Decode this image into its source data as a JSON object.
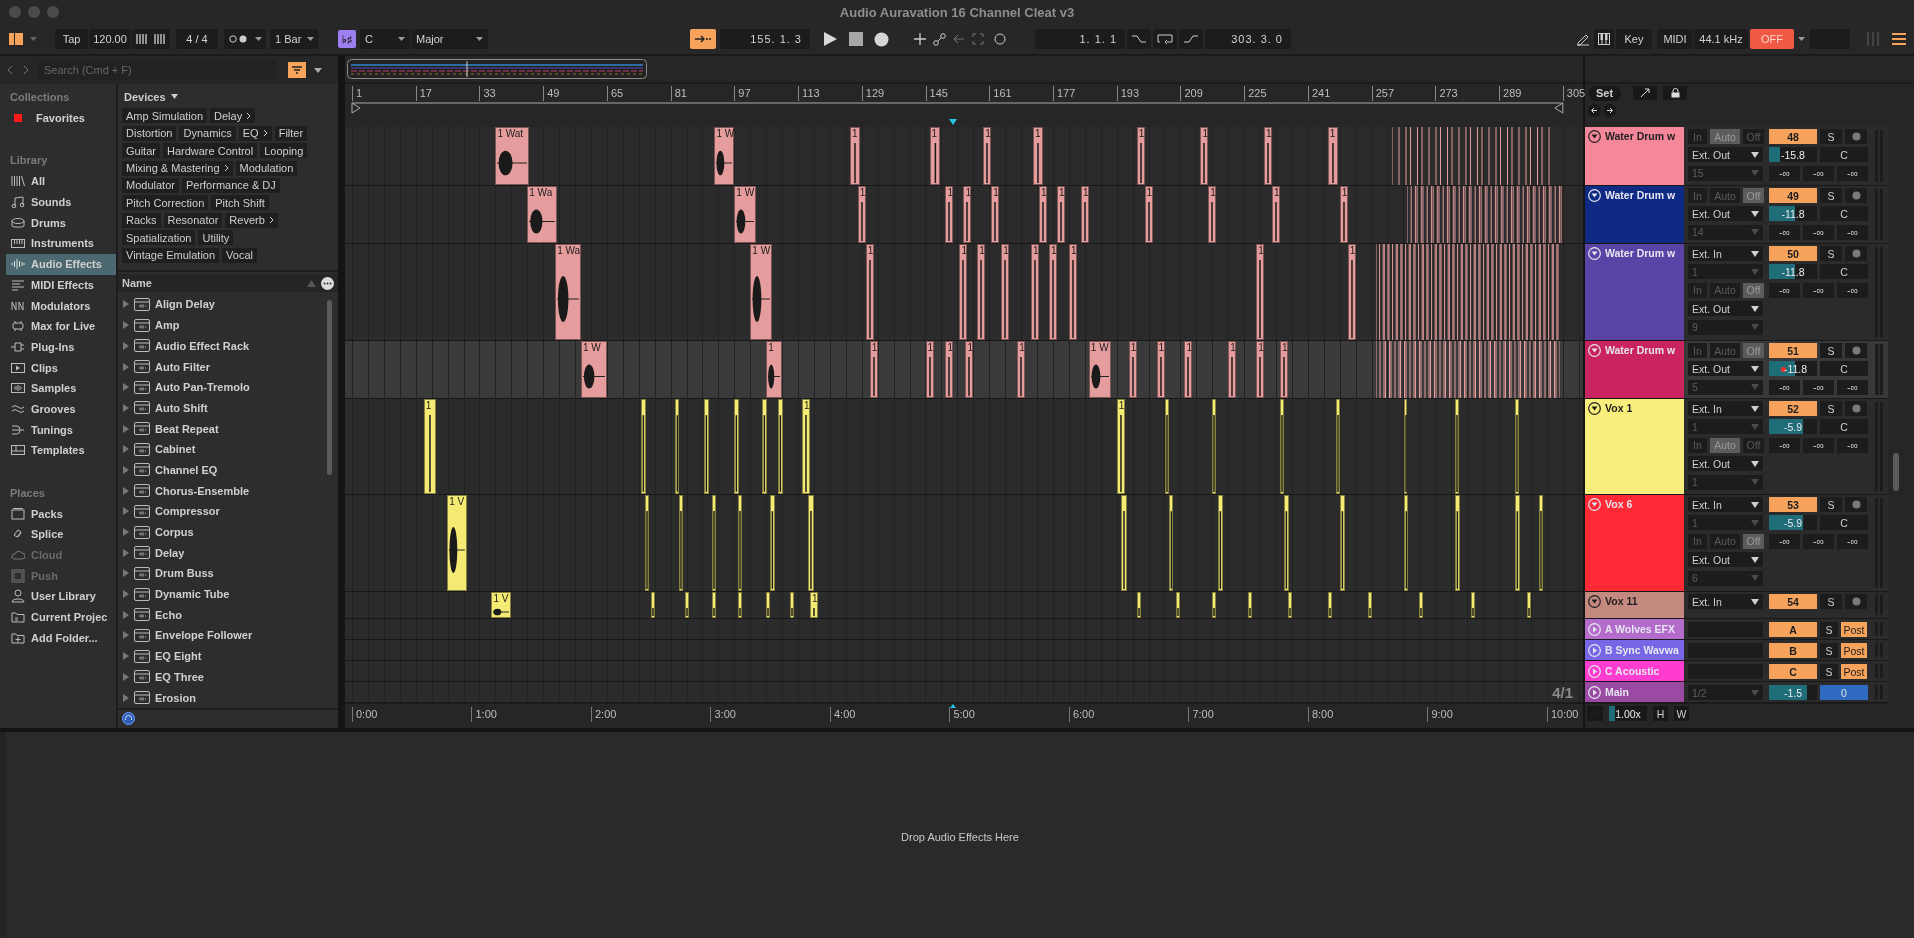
{
  "window": {
    "title": "Audio Auravation 16 Channel Cleat v3"
  },
  "transport": {
    "tap": "Tap",
    "tempo": "120.00",
    "signature": "4 / 4",
    "quantize": "1 Bar",
    "key_signature": "♭♯",
    "key": "C",
    "scale": "Major",
    "position": "155. 1. 3",
    "loop_start": "1. 1. 1",
    "loop_length": "303. 3. 0",
    "key_map": "Key",
    "midi_map": "MIDI",
    "sample_rate": "44.1 kHz",
    "status": "OFF"
  },
  "browser": {
    "search": {
      "placeholder": "Search (Cmd + F)"
    },
    "collections": {
      "heading": "Collections",
      "items": [
        {
          "label": "Favorites",
          "color": "#ff1a1a"
        }
      ]
    },
    "library": {
      "heading": "Library",
      "items": [
        {
          "label": "All",
          "selected": false
        },
        {
          "label": "Sounds",
          "selected": false
        },
        {
          "label": "Drums",
          "selected": false
        },
        {
          "label": "Instruments",
          "selected": false
        },
        {
          "label": "Audio Effects",
          "selected": true
        },
        {
          "label": "MIDI Effects",
          "selected": false
        },
        {
          "label": "Modulators",
          "selected": false
        },
        {
          "label": "Max for Live",
          "selected": false
        },
        {
          "label": "Plug-Ins",
          "selected": false
        },
        {
          "label": "Clips",
          "selected": false
        },
        {
          "label": "Samples",
          "selected": false
        },
        {
          "label": "Grooves",
          "selected": false
        },
        {
          "label": "Tunings",
          "selected": false
        },
        {
          "label": "Templates",
          "selected": false
        }
      ]
    },
    "places": {
      "heading": "Places",
      "items": [
        {
          "label": "Packs",
          "disabled": false
        },
        {
          "label": "Splice",
          "disabled": false
        },
        {
          "label": "Cloud",
          "disabled": true
        },
        {
          "label": "Push",
          "disabled": true
        },
        {
          "label": "User Library",
          "disabled": false
        },
        {
          "label": "Current Projec",
          "disabled": false
        },
        {
          "label": "Add Folder...",
          "disabled": false
        }
      ]
    },
    "devices": {
      "heading": "Devices",
      "tags": [
        {
          "label": "Amp Simulation",
          "expandable": false
        },
        {
          "label": "Delay",
          "expandable": true
        },
        {
          "label": "Distortion",
          "expandable": false
        },
        {
          "label": "Dynamics",
          "expandable": false
        },
        {
          "label": "EQ",
          "expandable": true
        },
        {
          "label": "Filter",
          "expandable": false
        },
        {
          "label": "Guitar",
          "expandable": false
        },
        {
          "label": "Hardware Control",
          "expandable": false
        },
        {
          "label": "Looping",
          "expandable": false
        },
        {
          "label": "Mixing & Mastering",
          "expandable": true
        },
        {
          "label": "Modulation",
          "expandable": false
        },
        {
          "label": "Modulator",
          "expandable": false
        },
        {
          "label": "Performance & DJ",
          "expandable": false
        },
        {
          "label": "Pitch Correction",
          "expandable": false
        },
        {
          "label": "Pitch Shift",
          "expandable": false
        },
        {
          "label": "Racks",
          "expandable": false
        },
        {
          "label": "Resonator",
          "expandable": false
        },
        {
          "label": "Reverb",
          "expandable": true
        },
        {
          "label": "Spatialization",
          "expandable": false
        },
        {
          "label": "Utility",
          "expandable": false
        },
        {
          "label": "Vintage Emulation",
          "expandable": false
        },
        {
          "label": "Vocal",
          "expandable": false
        }
      ]
    },
    "list": {
      "column": "Name",
      "items": [
        "Align Delay",
        "Amp",
        "Audio Effect Rack",
        "Auto Filter",
        "Auto Pan-Tremolo",
        "Auto Shift",
        "Beat Repeat",
        "Cabinet",
        "Channel EQ",
        "Chorus-Ensemble",
        "Compressor",
        "Corpus",
        "Delay",
        "Drum Buss",
        "Dynamic Tube",
        "Echo",
        "Envelope Follower",
        "EQ Eight",
        "EQ Three",
        "Erosion"
      ]
    }
  },
  "arrangement": {
    "ruler": [
      "1",
      "17",
      "33",
      "49",
      "65",
      "81",
      "97",
      "113",
      "129",
      "145",
      "161",
      "177",
      "193",
      "209",
      "225",
      "241",
      "257",
      "273",
      "289",
      "305"
    ],
    "time_ruler": [
      "0:00",
      "1:00",
      "2:00",
      "3:00",
      "4:00",
      "5:00",
      "6:00",
      "7:00",
      "8:00",
      "9:00",
      "10:00"
    ],
    "zoom_label": "4/1"
  },
  "header": {
    "set": "Set"
  },
  "tracks": [
    {
      "kind": "audio",
      "name": "Water Drum w",
      "color": "#f4889a",
      "selected": false,
      "clips": [
        {
          "label": "1 Wat",
          "color": "#e59c9c"
        },
        {
          "label": "1 W",
          "color": "#e59c9c"
        },
        {
          "label": "1",
          "color": "#e59c9c"
        },
        {
          "label": "1",
          "color": "#e59c9c"
        },
        {
          "label": "1",
          "color": "#e59c9c"
        },
        {
          "label": "1",
          "color": "#e59c9c"
        },
        {
          "label": "1",
          "color": "#e59c9c"
        },
        {
          "label": "1",
          "color": "#e59c9c"
        },
        {
          "label": "1",
          "color": "#e59c9c"
        },
        {
          "label": "1",
          "color": "#e59c9c"
        }
      ],
      "io": [
        {
          "kind": "monitor",
          "options": [
            {
              "label": "In",
              "selected": false
            },
            {
              "label": "Auto",
              "selected": true
            },
            {
              "label": "Off",
              "selected": false
            }
          ]
        },
        {
          "kind": "dropdown",
          "value": "Ext. Out",
          "disabled": false
        },
        {
          "kind": "dropdown",
          "value": "15",
          "disabled": true
        }
      ],
      "number": "48",
      "solo": "S",
      "volume": {
        "value": "-15.8",
        "level": 0.22
      },
      "automated": false,
      "pan": "C",
      "sends": [
        "-∞",
        "-∞",
        "-∞"
      ]
    },
    {
      "kind": "audio",
      "name": "Water Drum w",
      "color": "#0f2a84",
      "selected": false,
      "clips": [
        {
          "label": "1 Wa",
          "color": "#e59c9c"
        },
        {
          "label": "1 W",
          "color": "#e59c9c"
        },
        {
          "label": "1",
          "color": "#e59c9c"
        },
        {
          "label": "1",
          "color": "#e59c9c"
        },
        {
          "label": "1",
          "color": "#e59c9c"
        },
        {
          "label": "1",
          "color": "#e59c9c"
        },
        {
          "label": "1",
          "color": "#e59c9c"
        },
        {
          "label": "1",
          "color": "#e59c9c"
        },
        {
          "label": "1",
          "color": "#e59c9c"
        },
        {
          "label": "1",
          "color": "#e59c9c"
        },
        {
          "label": "1",
          "color": "#e59c9c"
        },
        {
          "label": "1",
          "color": "#e59c9c"
        },
        {
          "label": "1",
          "color": "#e59c9c"
        }
      ],
      "io": [
        {
          "kind": "monitor",
          "options": [
            {
              "label": "In",
              "selected": false
            },
            {
              "label": "Auto",
              "selected": false
            },
            {
              "label": "Off",
              "selected": true
            }
          ]
        },
        {
          "kind": "dropdown",
          "value": "Ext. Out",
          "disabled": false
        },
        {
          "kind": "dropdown",
          "value": "14",
          "disabled": true
        }
      ],
      "number": "49",
      "solo": "S",
      "volume": {
        "value": "-11.8",
        "level": 0.54
      },
      "automated": false,
      "pan": "C",
      "sends": [
        "-∞",
        "-∞",
        "-∞"
      ]
    },
    {
      "kind": "audio",
      "name": "Water Drum w",
      "color": "#5944a6",
      "selected": false,
      "clips": [
        {
          "label": "1 Wa",
          "color": "#e59c9c"
        },
        {
          "label": "1 W",
          "color": "#e59c9c"
        },
        {
          "label": "1",
          "color": "#e59c9c"
        },
        {
          "label": "1",
          "color": "#e59c9c"
        },
        {
          "label": "1",
          "color": "#e59c9c"
        },
        {
          "label": "1",
          "color": "#e59c9c"
        },
        {
          "label": "1",
          "color": "#e59c9c"
        },
        {
          "label": "1",
          "color": "#e59c9c"
        },
        {
          "label": "1",
          "color": "#e59c9c"
        },
        {
          "label": "1",
          "color": "#e59c9c"
        },
        {
          "label": "1",
          "color": "#e59c9c"
        }
      ],
      "io": [
        {
          "kind": "dropdown",
          "value": "Ext. In",
          "disabled": false
        },
        {
          "kind": "dropdown",
          "value": "1",
          "disabled": true
        },
        {
          "kind": "monitor",
          "options": [
            {
              "label": "In",
              "selected": false
            },
            {
              "label": "Auto",
              "selected": false
            },
            {
              "label": "Off",
              "selected": true
            }
          ]
        },
        {
          "kind": "dropdown",
          "value": "Ext. Out",
          "disabled": false
        },
        {
          "kind": "dropdown",
          "value": "9",
          "disabled": true
        }
      ],
      "number": "50",
      "solo": "S",
      "volume": {
        "value": "-11.8",
        "level": 0.54
      },
      "automated": false,
      "pan": "C",
      "sends": [
        "-∞",
        "-∞",
        "-∞"
      ]
    },
    {
      "kind": "audio",
      "name": "Water Drum w",
      "color": "#c9245f",
      "selected": true,
      "clips": [
        {
          "label": "1 W",
          "color": "#e59c9c"
        },
        {
          "label": "1",
          "color": "#e59c9c"
        },
        {
          "label": "1",
          "color": "#e59c9c"
        },
        {
          "label": "1",
          "color": "#e59c9c"
        },
        {
          "label": "1",
          "color": "#e59c9c"
        },
        {
          "label": "1",
          "color": "#e59c9c"
        },
        {
          "label": "1",
          "color": "#e59c9c"
        },
        {
          "label": "1 W",
          "color": "#e59c9c"
        },
        {
          "label": "1",
          "color": "#e59c9c"
        },
        {
          "label": "1",
          "color": "#e59c9c"
        },
        {
          "label": "1",
          "color": "#e59c9c"
        },
        {
          "label": "1",
          "color": "#e59c9c"
        },
        {
          "label": "1",
          "color": "#e59c9c"
        },
        {
          "label": "1",
          "color": "#e59c9c"
        }
      ],
      "io": [
        {
          "kind": "monitor",
          "options": [
            {
              "label": "In",
              "selected": false
            },
            {
              "label": "Auto",
              "selected": false
            },
            {
              "label": "Off",
              "selected": true
            }
          ]
        },
        {
          "kind": "dropdown",
          "value": "Ext. Out",
          "disabled": false
        },
        {
          "kind": "dropdown",
          "value": "5",
          "disabled": true
        }
      ],
      "number": "51",
      "solo": "S",
      "volume": {
        "value": "-11.8",
        "level": 0.54
      },
      "automated": true,
      "pan": "C",
      "sends": [
        "-∞",
        "-∞",
        "-∞"
      ]
    },
    {
      "kind": "audio",
      "name": "Vox 1",
      "color": "#f8ee7c",
      "selected": false,
      "clips": [
        {
          "label": "1",
          "color": "#f5eb74"
        },
        {
          "label": "1",
          "color": "#f5eb74"
        },
        {
          "label": "1",
          "color": "#f5eb74"
        }
      ],
      "io": [
        {
          "kind": "dropdown",
          "value": "Ext. In",
          "disabled": false
        },
        {
          "kind": "dropdown",
          "value": "1",
          "disabled": true
        },
        {
          "kind": "monitor",
          "options": [
            {
              "label": "In",
              "selected": false
            },
            {
              "label": "Auto",
              "selected": true
            },
            {
              "label": "Off",
              "selected": false
            }
          ]
        },
        {
          "kind": "dropdown",
          "value": "Ext. Out",
          "disabled": false
        },
        {
          "kind": "dropdown",
          "value": "1",
          "disabled": true
        }
      ],
      "number": "52",
      "solo": "S",
      "volume": {
        "value": "-5.9",
        "level": 0.7
      },
      "automated": false,
      "pan": "C",
      "sends": [
        "-∞",
        "-∞",
        "-∞"
      ]
    },
    {
      "kind": "audio",
      "name": "Vox 6",
      "color": "#ff2a36",
      "selected": false,
      "clips": [
        {
          "label": "1 V",
          "color": "#f5eb74"
        }
      ],
      "io": [
        {
          "kind": "dropdown",
          "value": "Ext. In",
          "disabled": false
        },
        {
          "kind": "dropdown",
          "value": "1",
          "disabled": true
        },
        {
          "kind": "monitor",
          "options": [
            {
              "label": "In",
              "selected": false
            },
            {
              "label": "Auto",
              "selected": false
            },
            {
              "label": "Off",
              "selected": true
            }
          ]
        },
        {
          "kind": "dropdown",
          "value": "Ext. Out",
          "disabled": false
        },
        {
          "kind": "dropdown",
          "value": "6",
          "disabled": true
        }
      ],
      "number": "53",
      "solo": "S",
      "volume": {
        "value": "-5.9",
        "level": 0.7
      },
      "automated": false,
      "pan": "C",
      "sends": [
        "-∞",
        "-∞",
        "-∞"
      ]
    },
    {
      "kind": "audio",
      "name": "Vox 11",
      "color": "#c48a80",
      "selected": false,
      "clips": [
        {
          "label": "1 V",
          "color": "#f5eb74"
        },
        {
          "label": "1",
          "color": "#f5eb74"
        }
      ],
      "io": [
        {
          "kind": "dropdown",
          "value": "Ext. In",
          "disabled": false
        }
      ],
      "number": "54",
      "solo": "S"
    },
    {
      "kind": "return",
      "name": "A Wolves EFX",
      "color": "#b36ccc",
      "number": "A",
      "solo": "S",
      "post": "Post"
    },
    {
      "kind": "return",
      "name": "B Sync Wavwa",
      "color": "#7766e6",
      "number": "B",
      "solo": "S",
      "post": "Post"
    },
    {
      "kind": "return",
      "name": "C Acoustic",
      "color": "#ff3cd0",
      "number": "C",
      "solo": "S",
      "post": "Post"
    },
    {
      "kind": "main",
      "name": "Main",
      "color": "#9a4aa2",
      "io": [
        {
          "kind": "dropdown",
          "value": "1/2",
          "disabled": true
        }
      ],
      "volume": {
        "value": "-1.5",
        "level": 0.8
      },
      "mix_value": "0"
    }
  ],
  "footer": {
    "zoom": {
      "value": "1.00x",
      "level": 0.15
    },
    "buttons": [
      "H",
      "W"
    ]
  },
  "device_area": {
    "hint": "Drop Audio Effects Here"
  }
}
